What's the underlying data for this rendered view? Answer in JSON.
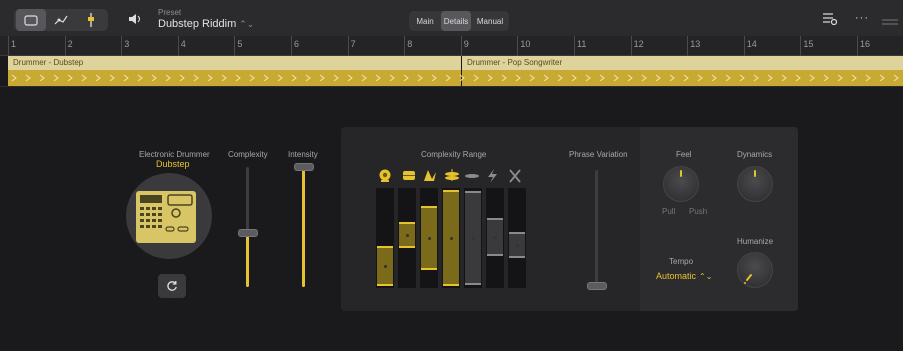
{
  "toolbar": {
    "icons": [
      "editor-view-icon",
      "automation-icon",
      "mixer-fader-icon",
      "speaker-icon",
      "settings-sliders-icon",
      "more-icon",
      "drag-handle-icon"
    ],
    "preset_caption": "Preset",
    "preset_value": "Dubstep Riddim",
    "tabs": [
      "Main",
      "Details",
      "Manual"
    ],
    "active_tab": "Details",
    "more_label": "···"
  },
  "ruler": {
    "bars": [
      "1",
      "2",
      "3",
      "4",
      "5",
      "6",
      "7",
      "8",
      "9",
      "10",
      "11",
      "12",
      "13",
      "14",
      "15",
      "16"
    ]
  },
  "regions": [
    {
      "title": "Drummer - Dubstep"
    },
    {
      "title": "Drummer - Pop Songwriter"
    }
  ],
  "drummer": {
    "caption": "Electronic Drummer",
    "name": "Dubstep"
  },
  "sliders": {
    "complexity_label": "Complexity",
    "complexity_value": 0.45,
    "intensity_label": "Intensity",
    "intensity_value": 1.0
  },
  "complexity_range": {
    "label": "Complexity Range",
    "lane_icons": [
      "kick-icon",
      "snare-icon",
      "clap-icon",
      "hihat-icon",
      "cymbal-icon",
      "lightning-icon",
      "sticks-icon"
    ],
    "lanes": [
      {
        "low": 0.02,
        "high": 0.42,
        "active": true
      },
      {
        "low": 0.4,
        "high": 0.66,
        "active": true
      },
      {
        "low": 0.18,
        "high": 0.82,
        "active": true
      },
      {
        "low": 0.02,
        "high": 0.98,
        "active": true
      },
      {
        "low": 0.03,
        "high": 0.97,
        "active": false
      },
      {
        "low": 0.32,
        "high": 0.7,
        "active": false
      },
      {
        "low": 0.3,
        "high": 0.56,
        "active": false
      }
    ]
  },
  "phrase_variation": {
    "label": "Phrase Variation",
    "value": 0.0
  },
  "feel": {
    "label": "Feel",
    "left_label": "Pull",
    "right_label": "Push",
    "value": 0.5
  },
  "dynamics": {
    "label": "Dynamics",
    "value": 0.5
  },
  "tempo": {
    "label": "Tempo",
    "value": "Automatic"
  },
  "humanize": {
    "label": "Humanize",
    "value": 0.05
  },
  "colors": {
    "accent": "#e6c22e",
    "background": "#1a1a1c",
    "panel": "#262628",
    "region_head": "#ded39b",
    "region_body": "#c8a934"
  }
}
